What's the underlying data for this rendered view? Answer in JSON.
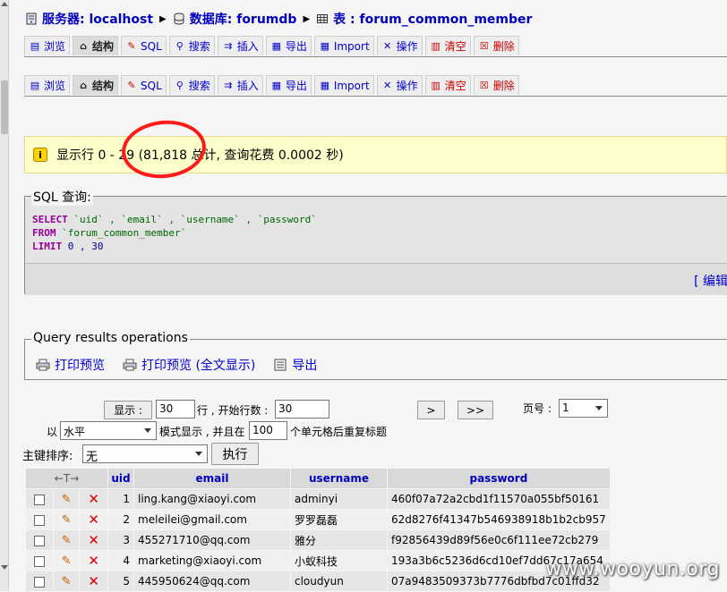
{
  "breadcrumb": {
    "server_label": "服务器: localhost",
    "db_label": "数据库: forumdb",
    "table_label": "表 : forum_common_member"
  },
  "tabs": [
    {
      "label": "浏览",
      "icon": "browse-icon"
    },
    {
      "label": "结构",
      "icon": "structure-icon",
      "active": true
    },
    {
      "label": "SQL",
      "icon": "sql-icon"
    },
    {
      "label": "搜索",
      "icon": "search-icon"
    },
    {
      "label": "插入",
      "icon": "insert-icon"
    },
    {
      "label": "导出",
      "icon": "export-icon"
    },
    {
      "label": "Import",
      "icon": "import-icon"
    },
    {
      "label": "操作",
      "icon": "operations-icon"
    },
    {
      "label": "清空",
      "icon": "empty-icon"
    },
    {
      "label": "删除",
      "icon": "drop-icon"
    }
  ],
  "notice": {
    "text": "显示行 0 - 29 (81,818 总计, 查询花费 0.0002 秒)"
  },
  "sql_box": {
    "legend": "SQL 查询:",
    "line1_kw": "SELECT",
    "line1_rest": " `uid` , `email` , `username` , `password`",
    "line2_kw": "FROM",
    "line2_rest": " `forum_common_member`",
    "line3_kw": "LIMIT",
    "line3_num": " 0 , 30",
    "edit_link": "[ 编辑"
  },
  "ops": {
    "legend": "Query results operations",
    "print_view": "打印预览",
    "print_view_full": "打印预览 (全文显示)",
    "export": "导出"
  },
  "nav": {
    "show_button": "显示 :",
    "rows_value": "30",
    "start_label": "行 , 开始行数 :",
    "start_value": "30",
    "next_button": ">",
    "last_button": ">>",
    "page_label": "页号 :",
    "page_value": "1",
    "mode_prefix": "以",
    "mode_value": "水平",
    "mode_label": "模式显示 , 并且在",
    "repeat_value": "100",
    "repeat_label": "个单元格后重复标题",
    "sort_label": "主键排序:",
    "sort_value": "无",
    "go_button": "执行"
  },
  "table": {
    "columns": [
      "uid",
      "email",
      "username",
      "password"
    ],
    "rows": [
      {
        "uid": "1",
        "email": "ling.kang@xiaoyi.com",
        "username": "adminyi",
        "password": "460f07a72a2cbd1f11570a055bf50161"
      },
      {
        "uid": "2",
        "email": "meleilei@gmail.com",
        "username": "罗罗磊磊",
        "password": "62d8276f41347b546938918b1b2cb957"
      },
      {
        "uid": "3",
        "email": "455271710@qq.com",
        "username": "雅分",
        "password": "f92856439d89f56e0c6f111ee72cb279"
      },
      {
        "uid": "4",
        "email": "marketing@xiaoyi.com",
        "username": "小蚁科技",
        "password": "193a3b6c5236d6cd10ef7dd67c17a654"
      },
      {
        "uid": "5",
        "email": "445950624@qq.com",
        "username": "cloudyun",
        "password": "07a9483509373b7776dbfbd7c01ffd32"
      }
    ]
  },
  "watermark": "www.wooyun.org"
}
